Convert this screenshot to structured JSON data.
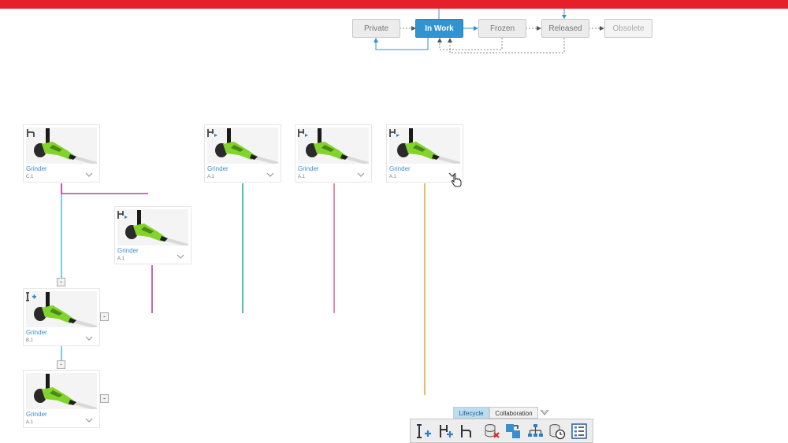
{
  "lifecycle": {
    "states": [
      {
        "label": "Private",
        "status": "normal"
      },
      {
        "label": "In Work",
        "status": "active"
      },
      {
        "label": "Frozen",
        "status": "normal"
      },
      {
        "label": "Released",
        "status": "normal"
      },
      {
        "label": "Obsolete",
        "status": "disabled"
      }
    ]
  },
  "cards": [
    {
      "title": "Grinder",
      "revision": "C.1",
      "kind_icon": "version-branch-icon"
    },
    {
      "title": "Grinder",
      "revision": "A.1",
      "kind_icon": "merge-version-icon"
    },
    {
      "title": "Grinder",
      "revision": "A.1",
      "kind_icon": "merge-version-icon"
    },
    {
      "title": "Grinder",
      "revision": "A.1",
      "kind_icon": "merge-version-icon"
    },
    {
      "title": "Grinder",
      "revision": "A.1",
      "kind_icon": "merge-version-icon"
    },
    {
      "title": "Grinder",
      "revision": "B.1",
      "kind_icon": "new-revision-icon"
    },
    {
      "title": "Grinder",
      "revision": "A.1",
      "kind_icon": ""
    }
  ],
  "toggles": [
    "-",
    "-",
    "-",
    "-"
  ],
  "panel": {
    "tabs": [
      {
        "label": "Lifecycle",
        "selected": true
      },
      {
        "label": "Collaboration",
        "selected": false
      }
    ],
    "tools": [
      "new-revision-icon",
      "new-branch-icon",
      "duplicate-icon",
      "delete-database-icon",
      "replace-by-revision-icon",
      "revision-graph-icon",
      "history-clock-icon",
      "properties-list-icon"
    ]
  },
  "colors": {
    "brand_bar": "#e5202a",
    "active_state": "#3193cf",
    "link_blue": "#5bbde0",
    "link_magenta": "#c040a0",
    "link_pink": "#e070a0",
    "link_teal": "#26b3a8",
    "link_orange": "#e6a84a"
  }
}
